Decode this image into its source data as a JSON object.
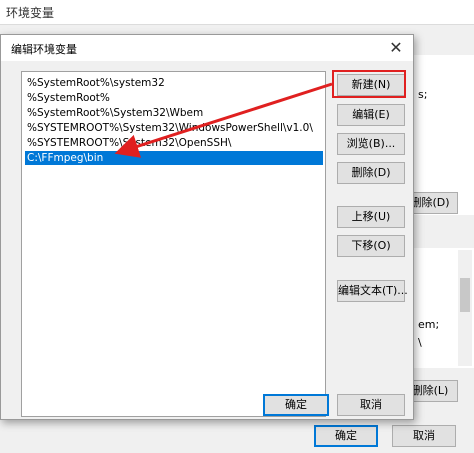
{
  "background_window": {
    "title": "环境变量",
    "right_text_1": "s;",
    "right_text_2": "em;",
    "right_text_3": "\\",
    "delete_button_1": "删除(D)",
    "delete_button_2": "删除(L)",
    "ok_button": "确定",
    "cancel_button": "取消"
  },
  "dialog": {
    "title": "编辑环境变量",
    "close_glyph": "✕",
    "list_items": [
      "%SystemRoot%\\system32",
      "%SystemRoot%",
      "%SystemRoot%\\System32\\Wbem",
      "%SYSTEMROOT%\\System32\\WindowsPowerShell\\v1.0\\",
      "%SYSTEMROOT%\\System32\\OpenSSH\\",
      "C:\\FFmpeg\\bin"
    ],
    "selected_index": 5,
    "buttons": {
      "new": "新建(N)",
      "edit": "编辑(E)",
      "browse": "浏览(B)...",
      "delete": "删除(D)",
      "move_up": "上移(U)",
      "move_down": "下移(O)",
      "edit_text": "编辑文本(T)...",
      "ok": "确定",
      "cancel": "取消"
    }
  },
  "annotation": {
    "highlight_color": "#e02020"
  }
}
